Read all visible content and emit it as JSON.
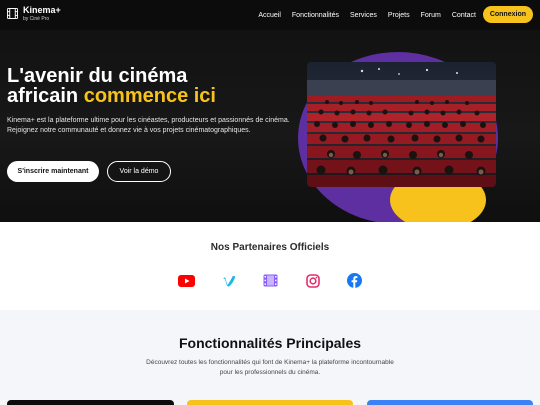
{
  "brand": {
    "name": "Kinema+",
    "subtitle": "by Ciné Pro"
  },
  "nav": {
    "links": [
      "Accueil",
      "Fonctionnalités",
      "Services",
      "Projets",
      "Forum",
      "Contact"
    ],
    "cta": "Connexion"
  },
  "hero": {
    "title_line1": "L'avenir du cinéma",
    "title_line2_white": "africain ",
    "title_line2_accent": "commence ici",
    "description": "Kinema+ est la plateforme ultime pour les cinéastes, producteurs et passionnés de cinéma. Rejoignez notre communauté et donnez vie à vos projets cinématographiques.",
    "primary_button": "S'inscrire maintenant",
    "secondary_button": "Voir la démo"
  },
  "partners": {
    "title": "Nos Partenaires Officiels",
    "icons": [
      "youtube-icon",
      "vimeo-icon",
      "film-icon",
      "instagram-icon",
      "facebook-icon"
    ]
  },
  "features": {
    "title": "Fonctionnalités Principales",
    "description": "Découvrez toutes les fonctionnalités qui font de Kinema+ la plateforme incontournable pour les professionnels du cinéma."
  },
  "colors": {
    "accent": "#f6c21b",
    "purple": "#5d2fa0",
    "dark": "#0c0c0c",
    "blue": "#3b82f6"
  }
}
